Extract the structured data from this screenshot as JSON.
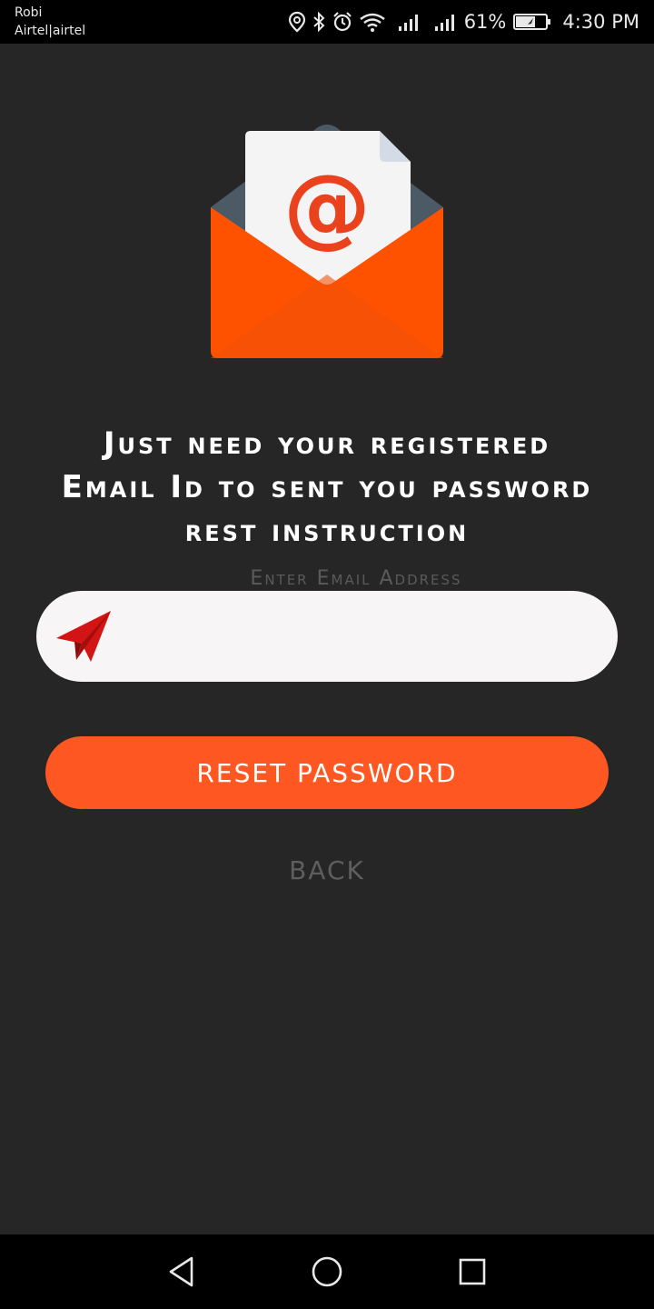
{
  "status_bar": {
    "carrier_line1": "Robi",
    "carrier_line2": "Airtel|airtel",
    "battery_percent": "61%",
    "time": "4:30 PM",
    "icons": [
      "location-icon",
      "bluetooth-icon",
      "alarm-icon",
      "wifi-icon",
      "signal-icon",
      "signal-icon",
      "battery-icon"
    ]
  },
  "illustration": {
    "icon": "email-envelope-icon",
    "symbol": "@",
    "colors": {
      "envelope": "#ff5200",
      "envelope_back": "#4c5a66",
      "letter": "#f4f4f4",
      "at_sign": "#e9421c"
    }
  },
  "headline": {
    "line1": "Just need your registered",
    "line2": "Email Id to sent you password",
    "line3": "rest instruction"
  },
  "email": {
    "label": "Enter Email Address",
    "value": "",
    "icon": "paper-plane-icon"
  },
  "actions": {
    "reset_label": "RESET PASSWORD",
    "back_label": "BACK"
  },
  "colors": {
    "background": "#262626",
    "accent": "#ff5722",
    "field_background": "#f7f5f6",
    "send_icon": "#d31414",
    "muted_text": "#5e5e5e"
  },
  "nav_bar": {
    "icons": [
      "back-triangle-icon",
      "home-circle-icon",
      "recents-square-icon"
    ]
  }
}
